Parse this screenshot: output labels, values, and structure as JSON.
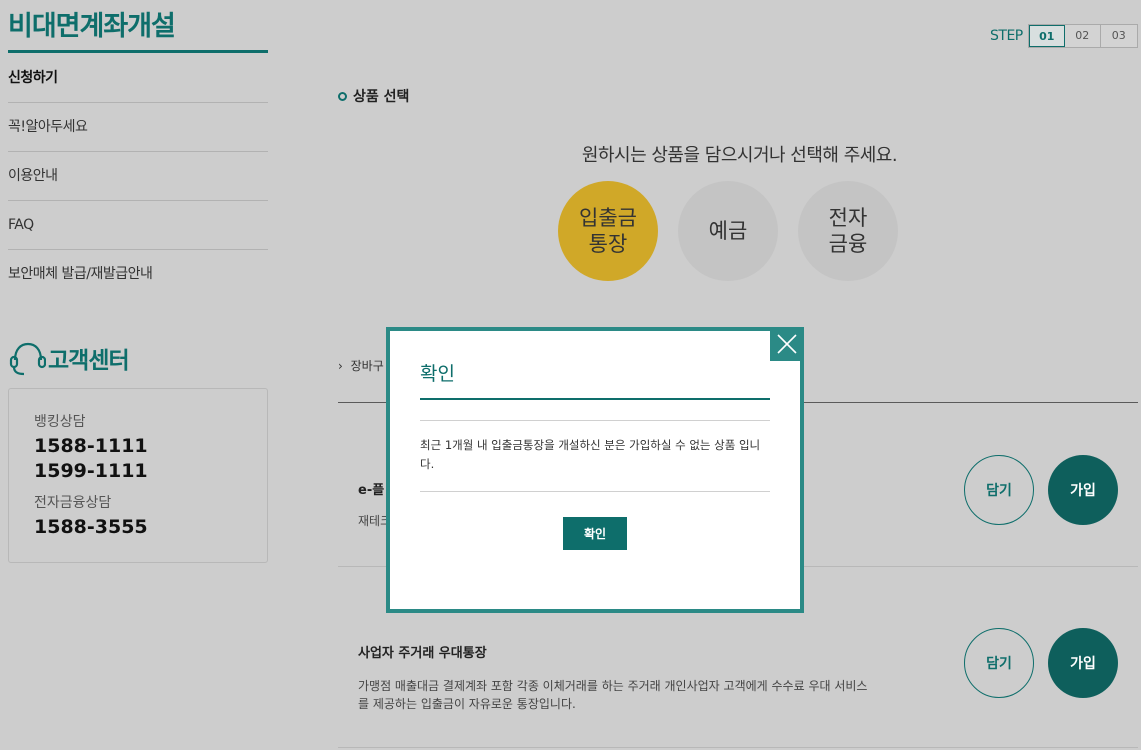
{
  "page_title": "비대면계좌개설",
  "sidebar": {
    "items": [
      {
        "label": "신청하기"
      },
      {
        "label": "꼭!알아두세요"
      },
      {
        "label": "이용안내"
      },
      {
        "label": "FAQ"
      },
      {
        "label": "보안매체 발급/재발급안내"
      }
    ]
  },
  "customer_center": {
    "title": "고객센터",
    "banking_label": "뱅킹상담",
    "banking_numbers": [
      "1588-1111",
      "1599-1111"
    ],
    "efinance_label": "전자금융상담",
    "efinance_number": "1588-3555"
  },
  "steps": {
    "label": "STEP",
    "items": [
      "01",
      "02",
      "03"
    ],
    "current": "01"
  },
  "main": {
    "section_title": "상품 선택",
    "instruction": "원하시는 상품을 담으시거나 선택해 주세요.",
    "categories": [
      {
        "label": "입출금\n통장",
        "selected": true
      },
      {
        "label": "예금",
        "selected": false
      },
      {
        "label": "전자\n금융",
        "selected": false
      }
    ],
    "cart_label": "장바구",
    "products": [
      {
        "name": "e-플",
        "desc": "재테크",
        "cart_button": "담기",
        "join_button": "가입"
      },
      {
        "name": "사업자 주거래 우대통장",
        "desc": "가맹점 매출대금 결제계좌 포함 각종 이체거래를 하는 주거래 개인사업자 고객에게 수수료 우대 서비스를 제공하는 입출금이 자유로운 통장입니다.",
        "cart_button": "담기",
        "join_button": "가입"
      }
    ]
  },
  "modal": {
    "title": "확인",
    "message": "최근 1개월 내 입출금통장을 개설하신 분은 가입하실 수 없는 상품 입니다.",
    "ok_button": "확인"
  },
  "colors": {
    "accent": "#0e6e6b",
    "selected_category": "#d0a828",
    "overlay_background": "#cdcdcd",
    "modal_border": "#2b8a86"
  }
}
